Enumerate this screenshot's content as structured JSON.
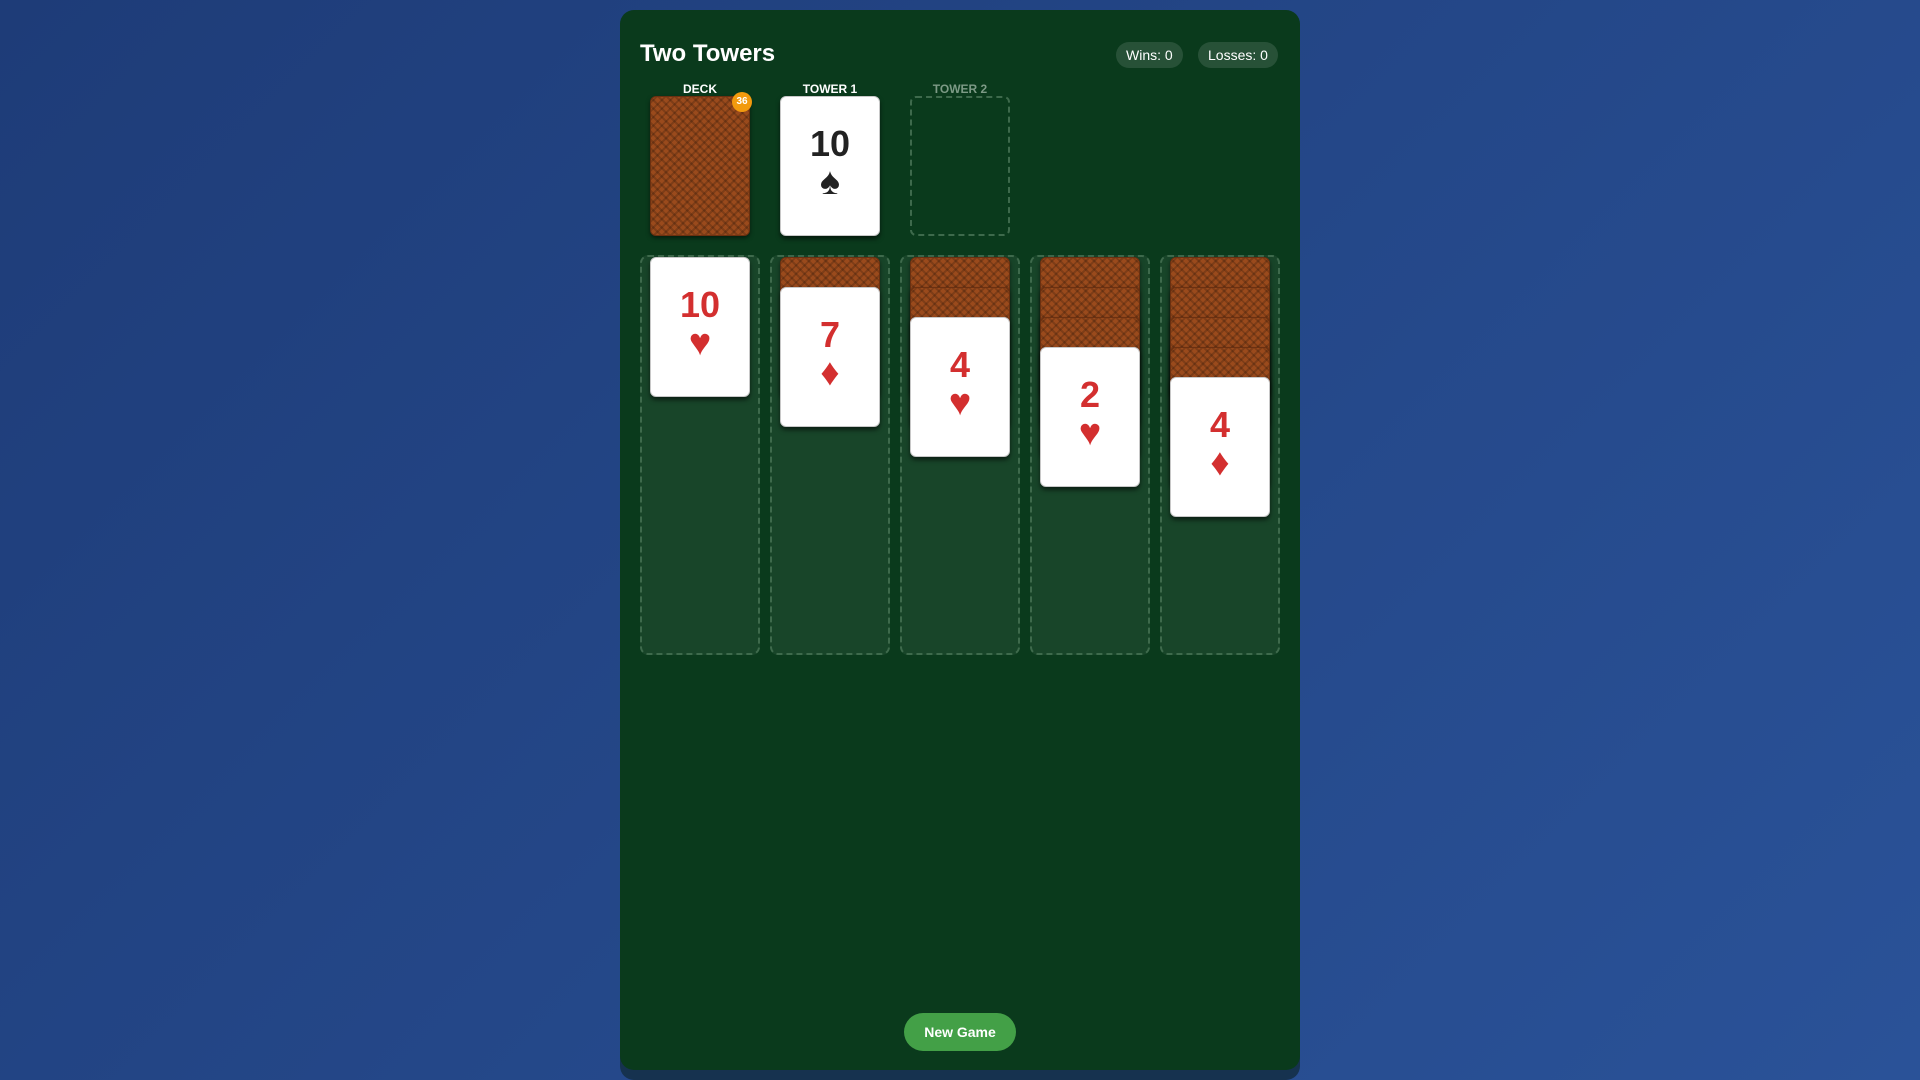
{
  "header": {
    "title": "Two Towers",
    "wins": "Wins: 0",
    "losses": "Losses: 0"
  },
  "slots": {
    "deck_label": "DECK",
    "tower1_label": "TOWER 1",
    "tower2_label": "TOWER 2",
    "deck_count": "36",
    "tower1_card": {
      "rank": "10",
      "suit": "♠",
      "color": "black"
    }
  },
  "tableau": [
    {
      "face_down": 0,
      "top": {
        "rank": "10",
        "suit": "♥",
        "color": "red"
      }
    },
    {
      "face_down": 1,
      "top": {
        "rank": "7",
        "suit": "♦",
        "color": "red"
      }
    },
    {
      "face_down": 2,
      "top": {
        "rank": "4",
        "suit": "♥",
        "color": "red"
      }
    },
    {
      "face_down": 3,
      "top": {
        "rank": "2",
        "suit": "♥",
        "color": "red"
      }
    },
    {
      "face_down": 4,
      "top": {
        "rank": "4",
        "suit": "♦",
        "color": "red"
      }
    }
  ],
  "actions": {
    "new_game": "New Game"
  },
  "colors": {
    "table": "#0a3a1c",
    "red_suit": "#d32f2f",
    "black_suit": "#222222",
    "button": "#43a047",
    "badge": "#f29a0e"
  }
}
